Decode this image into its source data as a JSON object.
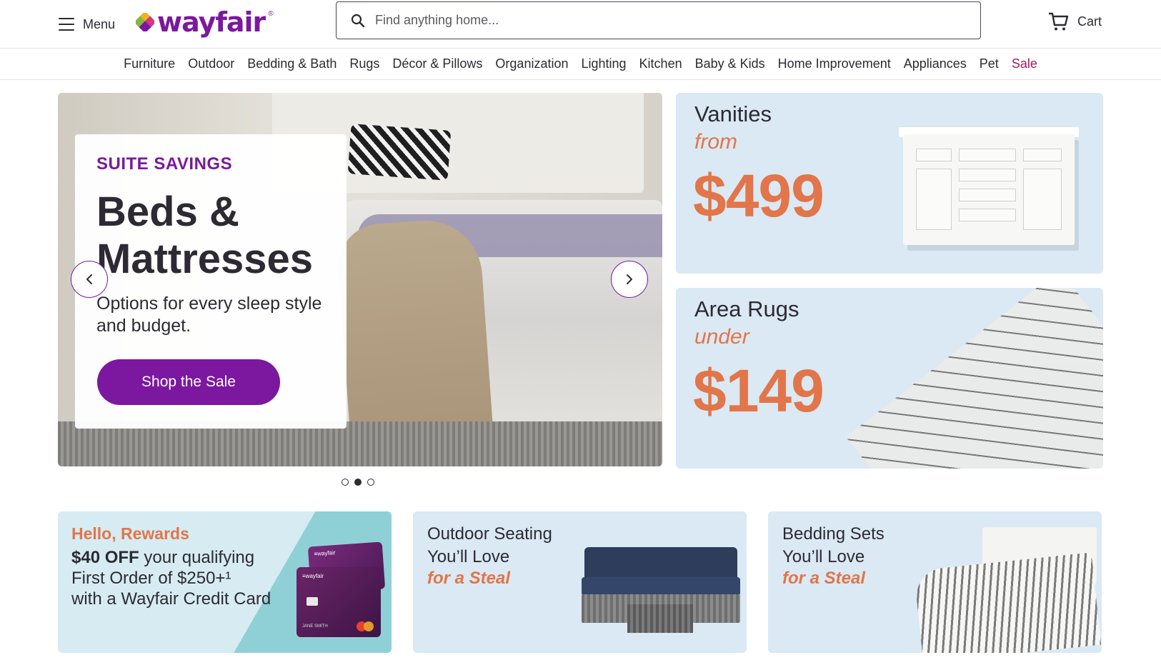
{
  "header": {
    "menu_label": "Menu",
    "logo_text": "wayfair",
    "search_placeholder": "Find anything home...",
    "cart_label": "Cart"
  },
  "categories": [
    "Furniture",
    "Outdoor",
    "Bedding & Bath",
    "Rugs",
    "Décor & Pillows",
    "Organization",
    "Lighting",
    "Kitchen",
    "Baby & Kids",
    "Home Improvement",
    "Appliances",
    "Pet",
    "Sale"
  ],
  "hero": {
    "eyebrow": "SUITE SAVINGS",
    "title": "Beds & Mattresses",
    "subtitle": "Options for every sleep style and budget.",
    "button": "Shop the Sale",
    "slides_total": 3,
    "active_slide": 2
  },
  "promos": {
    "vanities": {
      "label": "Vanities",
      "qualifier": "from",
      "price": "$499"
    },
    "rugs": {
      "label": "Area Rugs",
      "qualifier": "under",
      "price": "$149"
    }
  },
  "tiles": {
    "rewards": {
      "title": "Hello, Rewards",
      "offer": "$40 OFF",
      "body_1": " your qualifying",
      "body_2": "First Order of $250+¹",
      "body_3": "with a Wayfair Credit Card",
      "card_brand": "≡wayfair",
      "card_holder": "JANE SMITH"
    },
    "outdoor": {
      "line1": "Outdoor Seating",
      "line2": "You’ll Love",
      "steal": "for a Steal"
    },
    "bedding": {
      "line1": "Bedding Sets",
      "line2": "You’ll Love",
      "steal": "for a Steal"
    }
  },
  "colors": {
    "brand_purple": "#7b189f",
    "sale_magenta": "#a6195e",
    "accent_orange": "#e2754a",
    "promo_blue": "#dae9f3"
  }
}
